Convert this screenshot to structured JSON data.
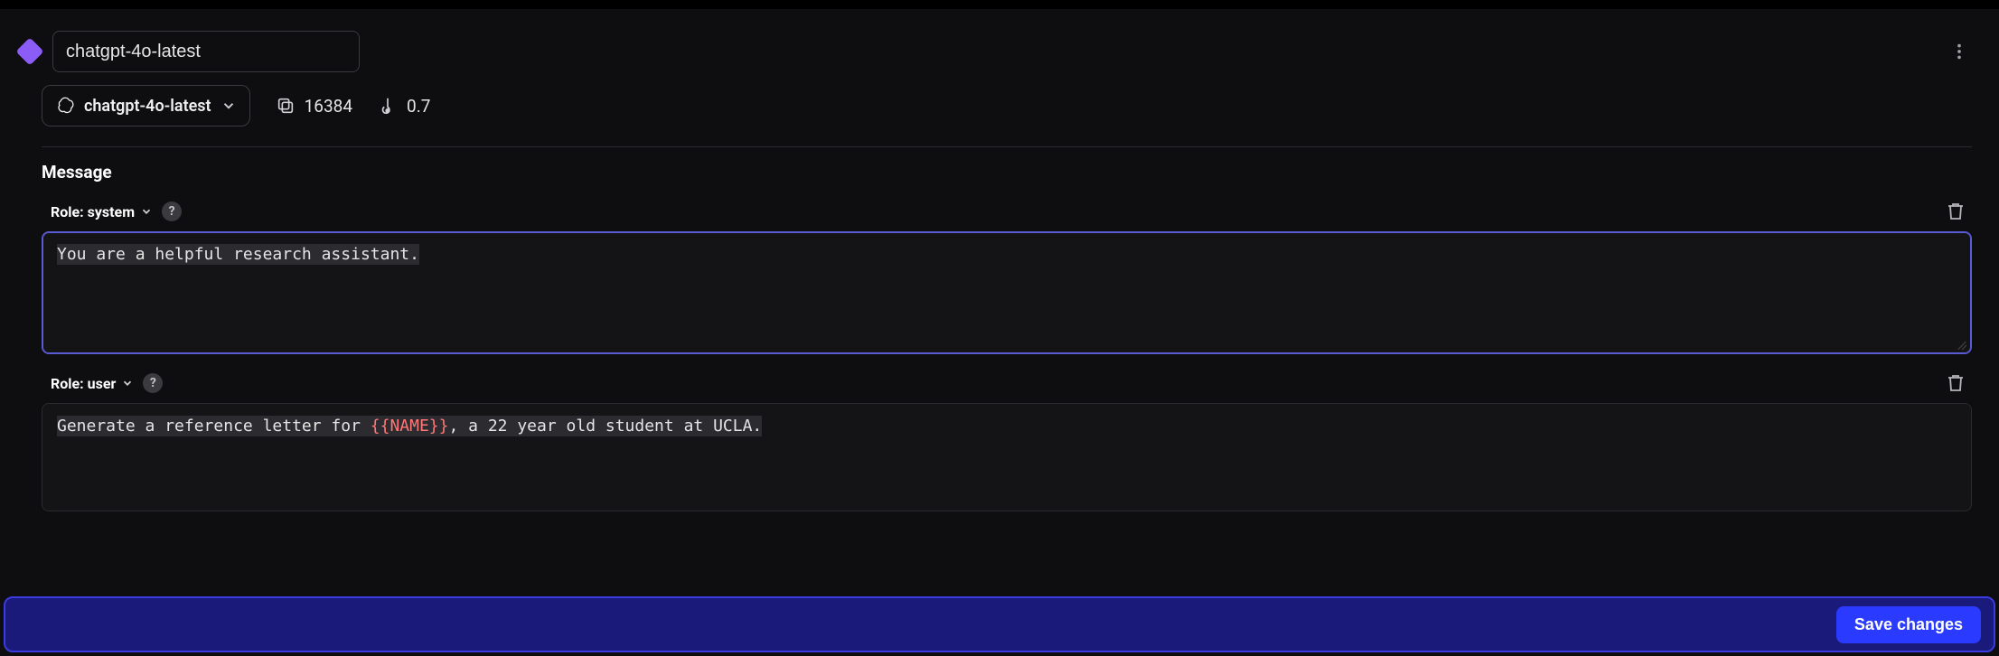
{
  "header": {
    "title_value": "chatgpt-4o-latest"
  },
  "controls": {
    "model_name": "chatgpt-4o-latest",
    "max_tokens": "16384",
    "temperature": "0.7"
  },
  "section_label": "Message",
  "messages": [
    {
      "role_label": "Role: system",
      "content_plain": "You are a helpful research assistant."
    },
    {
      "role_label": "Role: user",
      "content_prefix": "Generate a reference letter for ",
      "content_var": "{{NAME}}",
      "content_suffix": ", a 22 year old student at UCLA."
    }
  ],
  "footer": {
    "save_label": "Save changes"
  }
}
